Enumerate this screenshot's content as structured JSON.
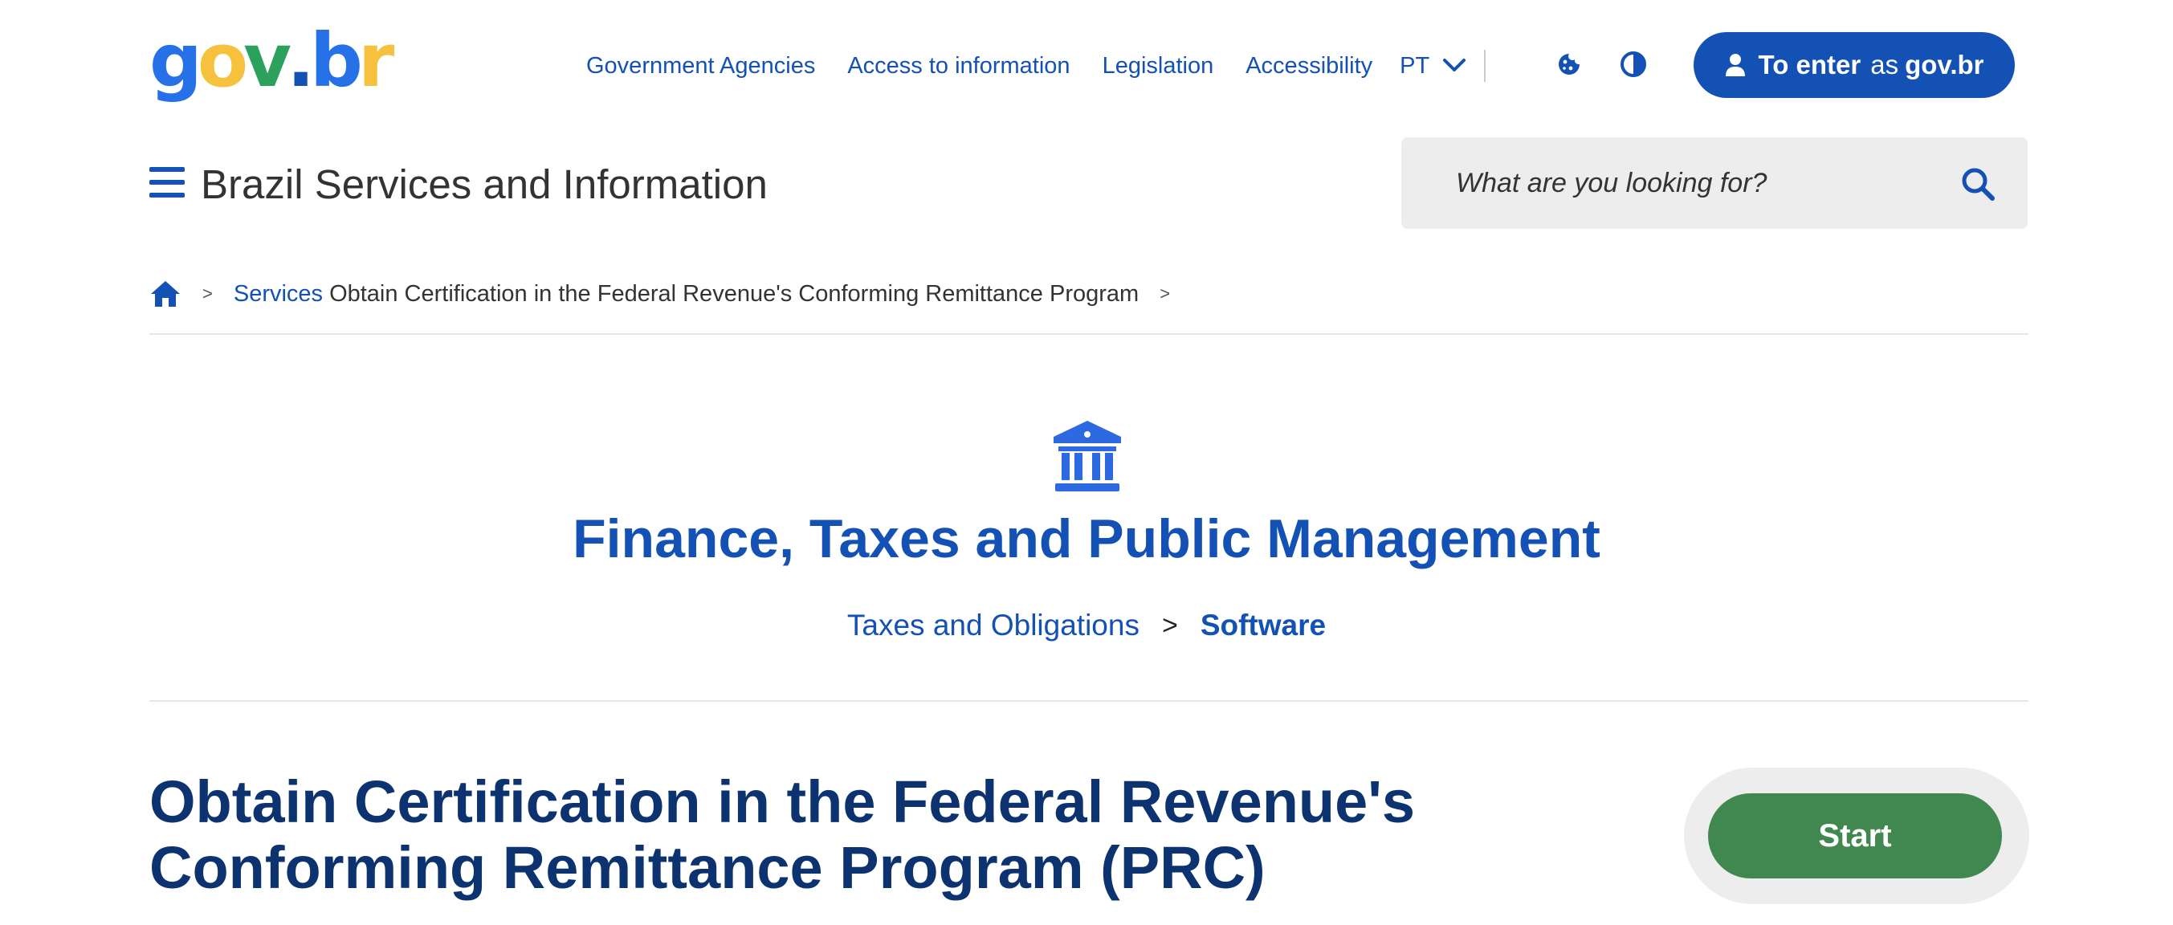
{
  "header": {
    "logo_text": "gov.br",
    "nav": [
      "Government Agencies",
      "Access to information",
      "Legislation",
      "Accessibility"
    ],
    "language": "PT",
    "enter_button": {
      "prefix": "To enter",
      "middle": "as",
      "brand": "gov.br"
    }
  },
  "site": {
    "title": "Brazil Services and Information",
    "search_placeholder": "What are you looking for?"
  },
  "breadcrumb": {
    "services": "Services",
    "current": "Obtain Certification in the Federal Revenue's Conforming Remittance Program",
    "separator": ">"
  },
  "category": {
    "title": "Finance, Taxes and Public Management",
    "subcategory": "Taxes and Obligations",
    "separator": ">",
    "active": "Software"
  },
  "service": {
    "title": "Obtain Certification in the Federal Revenue's Conforming Remittance Program (PRC)",
    "start_label": "Start"
  },
  "colors": {
    "primary_blue": "#1351b4",
    "dark_blue": "#0c326f",
    "start_green": "#408850",
    "search_bg": "#ededed"
  },
  "icons": {
    "menu": "hamburger-icon",
    "search": "search-icon",
    "home": "home-icon",
    "category": "bank-building-icon",
    "cookie": "cookie-icon",
    "contrast": "contrast-icon",
    "user": "user-icon",
    "language": "chevron-down-icon"
  }
}
